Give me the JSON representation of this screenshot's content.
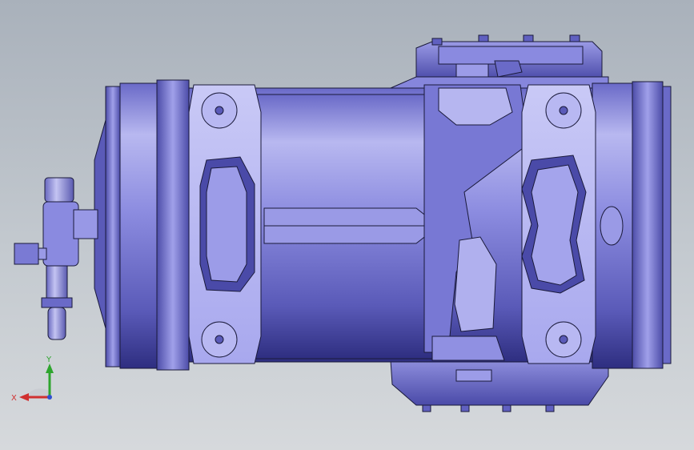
{
  "viewport": {
    "background_top": "#a9b1bb",
    "background_bottom": "#d6d9dc"
  },
  "model": {
    "name": "compressor-assembly",
    "body_color": "#7c7cd8",
    "body_light": "#c4c4f4",
    "body_dark": "#3d3d8f",
    "edge_color": "#1a1a3a"
  },
  "triad": {
    "x_label": "X",
    "y_label": "Y",
    "x_color": "#d03030",
    "y_color": "#2ea52e",
    "z_color": "#3050d0"
  }
}
